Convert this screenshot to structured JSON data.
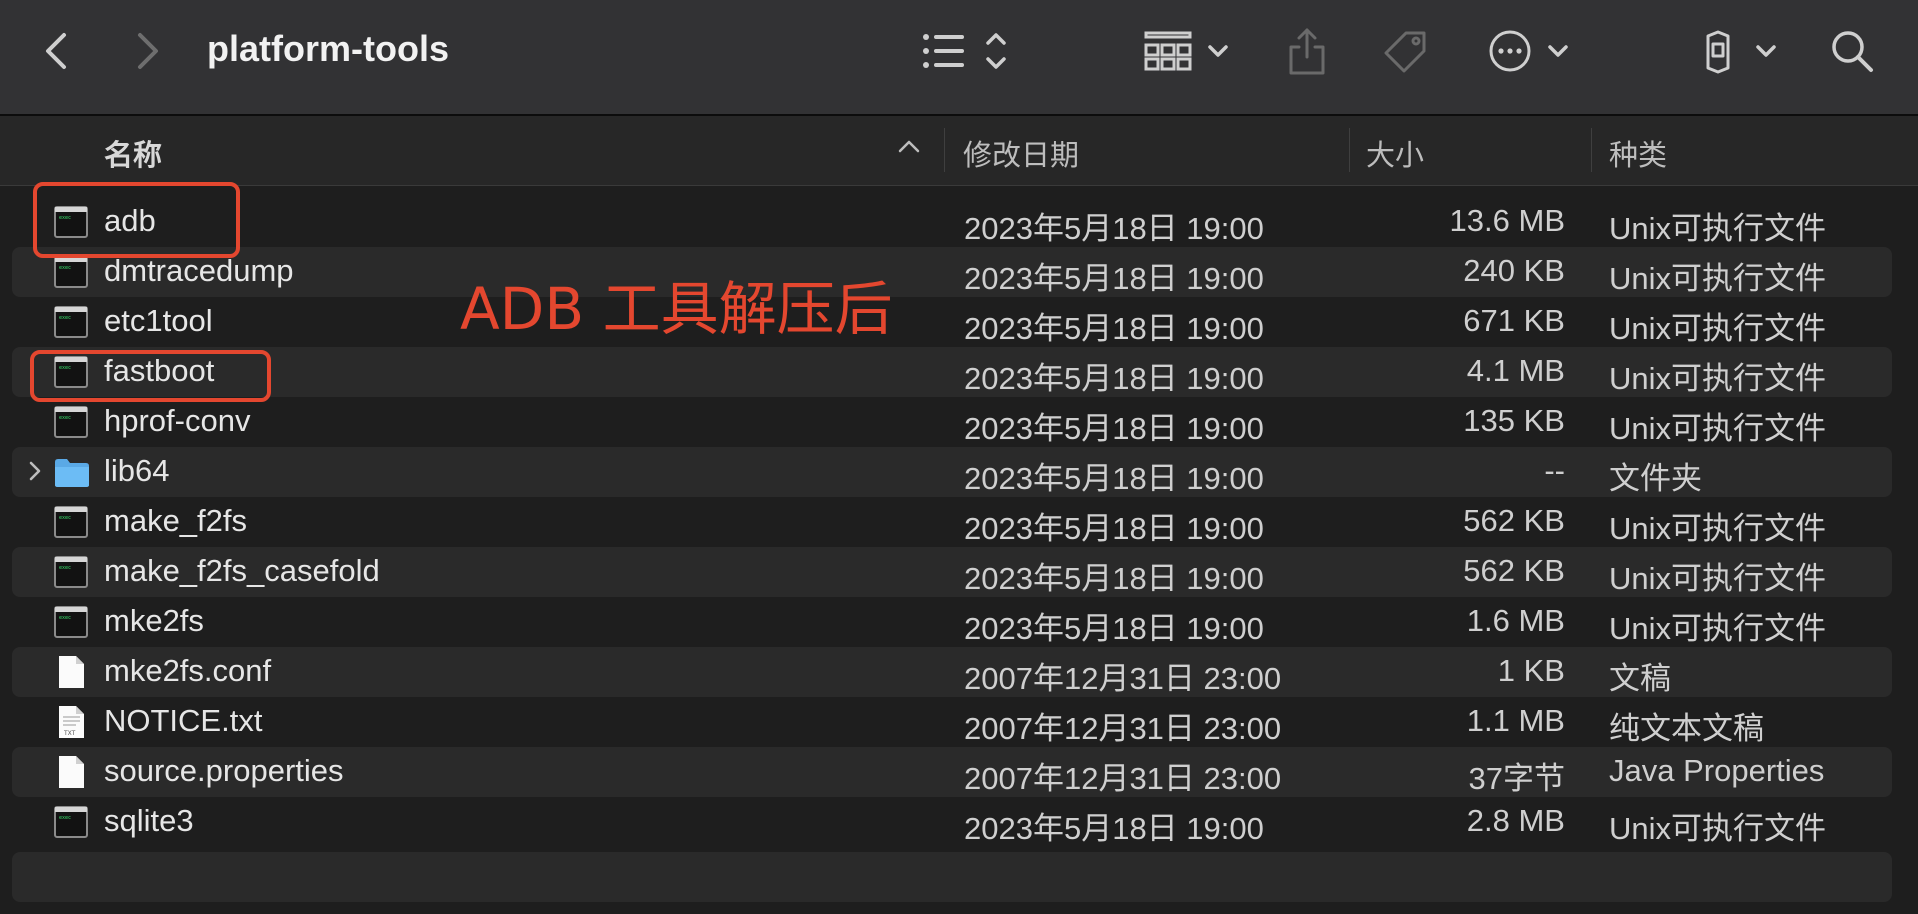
{
  "window": {
    "title": "platform-tools"
  },
  "toolbar": {
    "icons": [
      "back-icon",
      "forward-icon",
      "list-view-icon",
      "group-icon",
      "share-icon",
      "tag-icon",
      "more-icon",
      "dropbox-icon",
      "search-icon"
    ]
  },
  "columns": {
    "name": "名称",
    "date": "修改日期",
    "size": "大小",
    "kind": "种类"
  },
  "files": [
    {
      "name": "adb",
      "date": "2023年5月18日 19:00",
      "size": "13.6 MB",
      "kind": "Unix可执行文件",
      "icon": "exec"
    },
    {
      "name": "dmtracedump",
      "date": "2023年5月18日 19:00",
      "size": "240 KB",
      "kind": "Unix可执行文件",
      "icon": "exec"
    },
    {
      "name": "etc1tool",
      "date": "2023年5月18日 19:00",
      "size": "671 KB",
      "kind": "Unix可执行文件",
      "icon": "exec"
    },
    {
      "name": "fastboot",
      "date": "2023年5月18日 19:00",
      "size": "4.1 MB",
      "kind": "Unix可执行文件",
      "icon": "exec"
    },
    {
      "name": "hprof-conv",
      "date": "2023年5月18日 19:00",
      "size": "135 KB",
      "kind": "Unix可执行文件",
      "icon": "exec"
    },
    {
      "name": "lib64",
      "date": "2023年5月18日 19:00",
      "size": "--",
      "kind": "文件夹",
      "icon": "folder"
    },
    {
      "name": "make_f2fs",
      "date": "2023年5月18日 19:00",
      "size": "562 KB",
      "kind": "Unix可执行文件",
      "icon": "exec"
    },
    {
      "name": "make_f2fs_casefold",
      "date": "2023年5月18日 19:00",
      "size": "562 KB",
      "kind": "Unix可执行文件",
      "icon": "exec"
    },
    {
      "name": "mke2fs",
      "date": "2023年5月18日 19:00",
      "size": "1.6 MB",
      "kind": "Unix可执行文件",
      "icon": "exec"
    },
    {
      "name": "mke2fs.conf",
      "date": "2007年12月31日 23:00",
      "size": "1 KB",
      "kind": "文稿",
      "icon": "doc"
    },
    {
      "name": "NOTICE.txt",
      "date": "2007年12月31日 23:00",
      "size": "1.1 MB",
      "kind": "纯文本文稿",
      "icon": "txt"
    },
    {
      "name": "source.properties",
      "date": "2007年12月31日 23:00",
      "size": "37字节",
      "kind": "Java Properties",
      "icon": "doc"
    },
    {
      "name": "sqlite3",
      "date": "2023年5月18日 19:00",
      "size": "2.8 MB",
      "kind": "Unix可执行文件",
      "icon": "exec"
    }
  ],
  "annotation": {
    "text": "ADB 工具解压后",
    "color": "#e4472f"
  },
  "colors": {
    "accent": "#e4472f",
    "folder": "#5fb4f0"
  }
}
